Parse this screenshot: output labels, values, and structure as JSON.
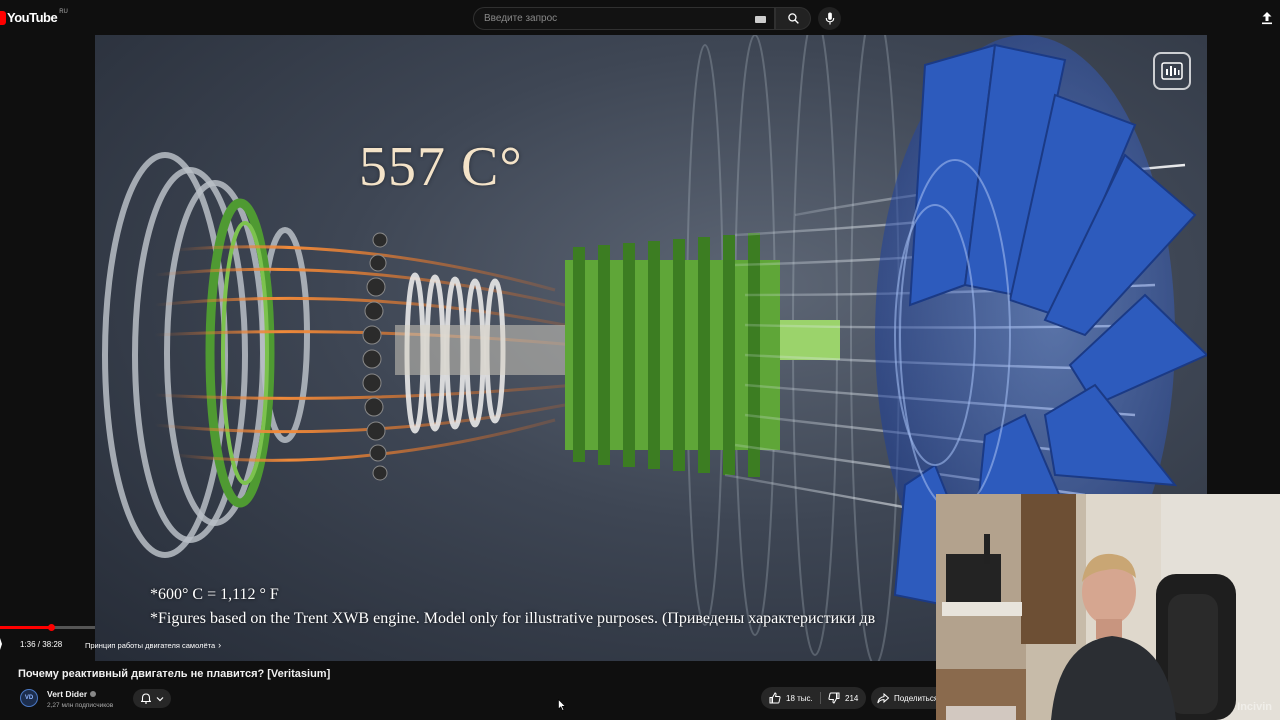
{
  "header": {
    "logo_text": "YouTube",
    "region": "RU",
    "search_placeholder": "Введите запрос"
  },
  "video": {
    "temperature_overlay": "557 C°",
    "caption_line1": "*600° C = 1,112 ° F",
    "caption_line2": "*Figures based on the Trent XWB engine. Model only for illustrative purposes. (Приведены характеристики дв",
    "progress_fraction": 0.041
  },
  "controls": {
    "timecode": "1:36 / 38:28",
    "chapter": "Принцип работы двигателя самолёта",
    "chapter_arrow": "›"
  },
  "meta": {
    "title": "Почему реактивный двигатель не плавится? [Veritasium]",
    "channel_name": "Vert Dider",
    "avatar_text": "VD",
    "subscribers": "2,27 млн подписчиков",
    "likes": "18 тыс.",
    "dislikes": "214",
    "share_label": "Поделиться"
  },
  "webcam": {
    "watermark": "Incivin"
  },
  "colors": {
    "background": "#0f0f0f",
    "accent_red": "#ff0000",
    "button_bg": "#272727",
    "engine_green": "#5fa638",
    "fan_blue": "#2e5fc4"
  },
  "icons": [
    "youtube-logo-icon",
    "keyboard-icon",
    "search-icon",
    "mic-icon",
    "upload-icon",
    "podcast-icon",
    "bell-icon",
    "chevron-down-icon",
    "thumb-up-icon",
    "thumb-down-icon",
    "share-icon",
    "cursor-icon",
    "verified-icon"
  ]
}
